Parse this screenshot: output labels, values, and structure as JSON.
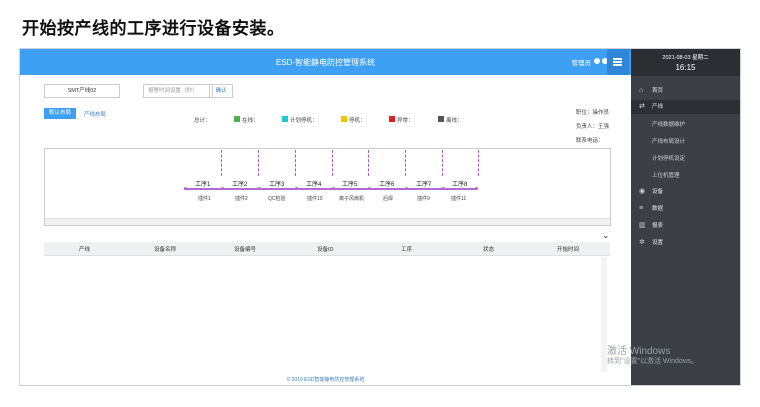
{
  "slide": {
    "title": "开始按产线的工序进行设备安装。"
  },
  "header": {
    "app_title": "ESD-智能静电防控管理系统",
    "admin": "管理员"
  },
  "sidebar": {
    "date": "2021-08-03 星期二",
    "time": "16:15",
    "items": [
      {
        "label": "首页",
        "icon": "home-icon"
      },
      {
        "label": "产线",
        "icon": "exchange-icon"
      },
      {
        "label": "设备",
        "icon": "devices-icon"
      },
      {
        "label": "数据",
        "icon": "database-icon"
      },
      {
        "label": "报表",
        "icon": "chart-icon"
      },
      {
        "label": "设置",
        "icon": "gears-icon"
      }
    ],
    "sub_items": [
      "产线数据维护",
      "产线布局设计",
      "计划停机设定",
      "上位机管理"
    ]
  },
  "toolbar": {
    "line_select": "SMT产线02",
    "time_placeholder": "报警时间设置（秒）",
    "confirm": "确认",
    "default_layout": "默认布局",
    "line_layout": "产线布局"
  },
  "status": {
    "total_label": "总计：",
    "legend": [
      {
        "label": "在线：",
        "color": "#4caf50"
      },
      {
        "label": "计划停机：",
        "color": "#26c6da"
      },
      {
        "label": "停机：",
        "color": "#f2c400"
      },
      {
        "label": "异常：",
        "color": "#e02020"
      },
      {
        "label": "离线：",
        "color": "#555555"
      }
    ]
  },
  "info": {
    "position": "职位：操作员",
    "owner": "负责人：王强",
    "phone": "联系电话："
  },
  "diagram": {
    "processes": [
      "工序1",
      "工序2",
      "工序3",
      "工序4",
      "工序5",
      "工序6",
      "工序7",
      "工序8"
    ],
    "devices": [
      "插件1",
      "插件2",
      "QC检验",
      "插件10",
      "离子风扇机",
      "后焊",
      "插件9",
      "插件11"
    ]
  },
  "table": {
    "headers": [
      "产线",
      "设备名称",
      "设备编号",
      "设备ID",
      "工序",
      "状态",
      "开始时间"
    ]
  },
  "watermark": {
    "line1": "激活 Windows",
    "line2": "转到\"设置\"以激活 Windows。"
  },
  "footer": {
    "text": "© 2019 ESD智能静电防控管理系统"
  }
}
